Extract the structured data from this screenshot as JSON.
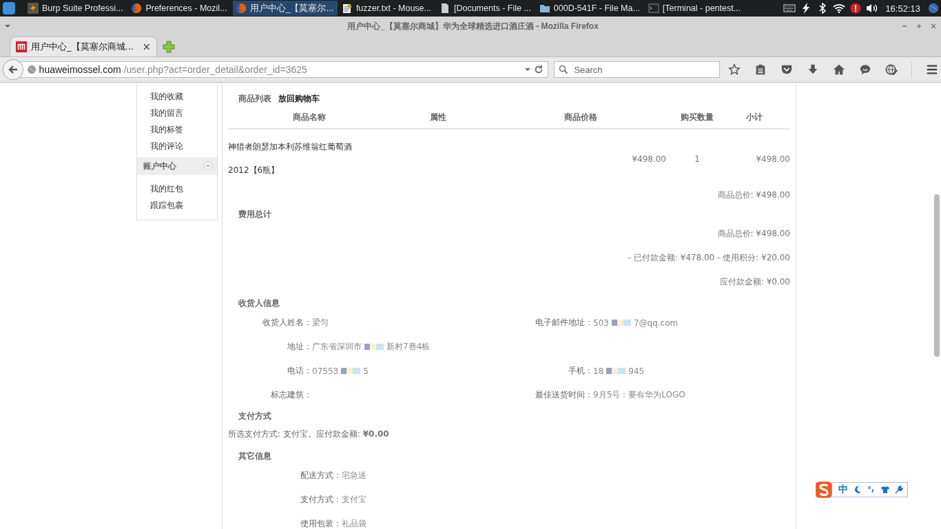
{
  "taskbar": {
    "tasks": [
      {
        "label": "Burp Suite Professi...",
        "kind": "burp",
        "selected": false
      },
      {
        "label": "Preferences - Mozil...",
        "kind": "browser",
        "selected": false
      },
      {
        "label": "用户中心_【莫塞尔...",
        "kind": "browser",
        "selected": true
      },
      {
        "label": "fuzzer.txt - Mouse...",
        "kind": "editor",
        "selected": false
      },
      {
        "label": "[Documents - File ...",
        "kind": "document",
        "selected": false
      },
      {
        "label": "000D-541F - File Ma...",
        "kind": "folder",
        "selected": false
      },
      {
        "label": "[Terminal - pentest...",
        "kind": "terminal",
        "selected": false
      }
    ],
    "clock": "16:52:13"
  },
  "window": {
    "title": "用户中心_【莫塞尔商城】华为全球精选进口酒庄酒 - Mozilla Firefox"
  },
  "tabs": [
    {
      "label": "用户中心_【莫塞尔商城...",
      "close": "×",
      "selected": true
    }
  ],
  "url": {
    "host": "huaweimossel.com",
    "path": "/user.php?act=order_detail&order_id=3625"
  },
  "search": {
    "placeholder": "Search"
  },
  "sidebar": {
    "items_top": [
      "我的收藏",
      "我的留言",
      "我的标签",
      "我的评论"
    ],
    "section": {
      "title": "账户中心",
      "expanded": true
    },
    "items": [
      "我的红包",
      "跟踪包裹"
    ]
  },
  "goods": {
    "heading": "商品列表",
    "back_link": "放回购物车",
    "columns": [
      "商品名称",
      "属性",
      "商品价格",
      "购买数量",
      "小计"
    ],
    "rows": [
      {
        "name_lines": [
          "神猎者朗瑟加本利苏维翁红葡萄酒",
          "2012【6瓶】"
        ],
        "price": "¥498.00",
        "qty": "1",
        "subtotal": "¥498.00"
      }
    ],
    "total": "商品总价: ¥498.00"
  },
  "fees": {
    "heading": "费用总计",
    "lines": [
      "商品总价: ¥498.00",
      "- 已付款金额: ¥478.00 - 使用积分: ¥20.00",
      "应付款金额: ¥0.00"
    ]
  },
  "consignee": {
    "heading": "收货人信息",
    "rows": [
      {
        "left": {
          "label": "收货人姓名：",
          "parts": [
            "梁匀"
          ]
        },
        "right": {
          "label": "电子邮件地址：",
          "parts": [
            "503",
            "7@qq.com"
          ]
        }
      },
      {
        "left": {
          "label": "地址：",
          "parts": [
            "广东省深圳市",
            "新村7巷4栋"
          ]
        }
      },
      {
        "left": {
          "label": "电话：",
          "parts": [
            "07553",
            "5"
          ]
        },
        "right": {
          "label": "手机：",
          "parts": [
            "18",
            "945"
          ]
        }
      },
      {
        "left": {
          "label": "标志建筑："
        },
        "right": {
          "label": "最佳送货时间：",
          "parts": [
            "9月5号：要有华为LOGO"
          ]
        }
      }
    ]
  },
  "payment": {
    "heading": "支付方式",
    "text": "所选支付方式: 支付宝。应付款金额: **¥0.00**"
  },
  "other": {
    "heading": "其它信息",
    "fields": [
      {
        "label": "配送方式：",
        "value": "宅急送"
      },
      {
        "label": "支付方式：",
        "value": "支付宝"
      },
      {
        "label": "使用包装：",
        "value": "礼品袋"
      }
    ]
  },
  "ime": {
    "mode": "中"
  }
}
